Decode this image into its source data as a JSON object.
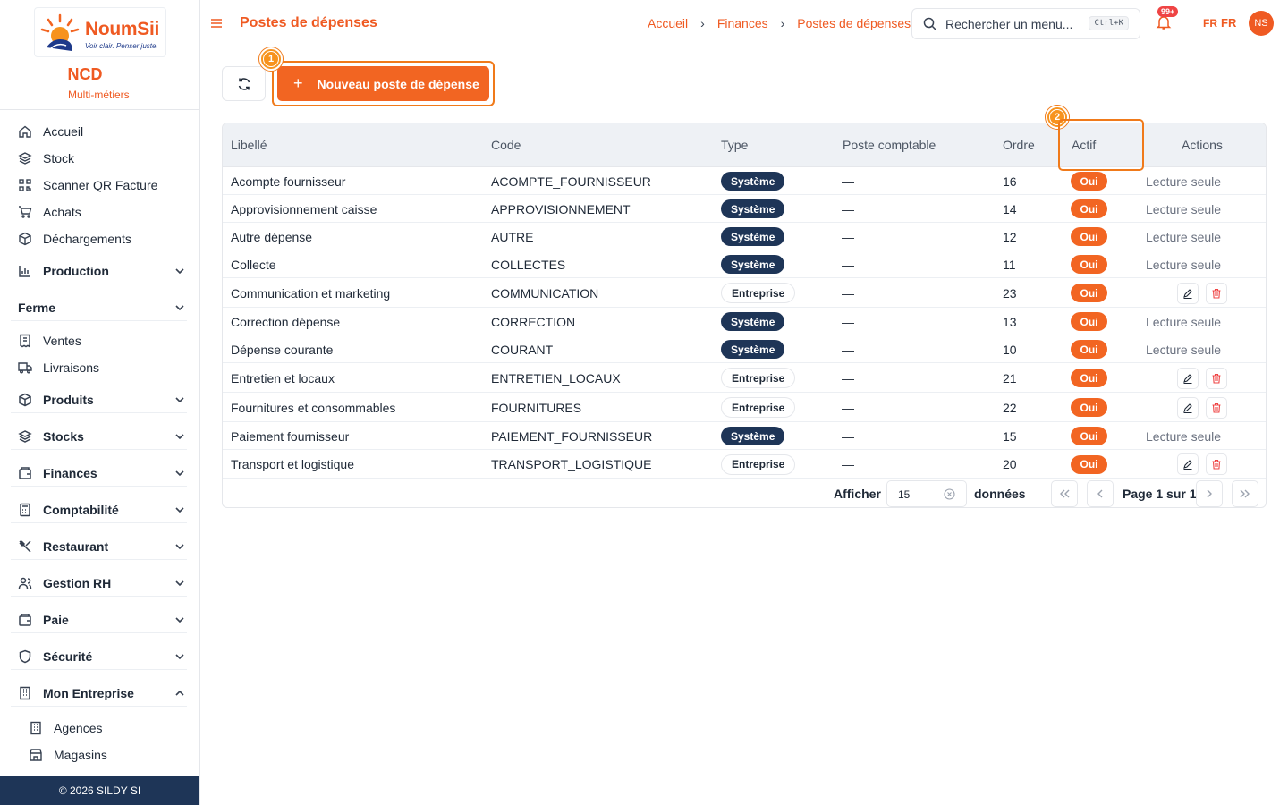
{
  "brand": {
    "logo_text": "NoumSii",
    "logo_tagline": "Voir clair. Penser juste.",
    "company": "NCD",
    "subtitle": "Multi-métiers"
  },
  "sidebar": {
    "items": [
      {
        "label": "Accueil",
        "icon": "home-icon"
      },
      {
        "label": "Stock",
        "icon": "layers-icon"
      },
      {
        "label": "Scanner QR Facture",
        "icon": "qr-icon"
      },
      {
        "label": "Achats",
        "icon": "cart-icon"
      },
      {
        "label": "Déchargements",
        "icon": "box-icon"
      }
    ],
    "groups": [
      {
        "label": "Production",
        "icon": "chart-icon",
        "expanded": false
      },
      {
        "label": "Ferme",
        "icon": "",
        "expanded": false
      },
      {
        "label": "Produits",
        "icon": "box-icon",
        "expanded": false
      },
      {
        "label": "Stocks",
        "icon": "layers-icon",
        "expanded": false
      },
      {
        "label": "Finances",
        "icon": "wallet-icon",
        "expanded": false
      },
      {
        "label": "Comptabilité",
        "icon": "calculator-icon",
        "expanded": false
      },
      {
        "label": "Restaurant",
        "icon": "utensils-icon",
        "expanded": false
      },
      {
        "label": "Gestion RH",
        "icon": "users-icon",
        "expanded": false
      },
      {
        "label": "Paie",
        "icon": "wallet-icon",
        "expanded": false
      },
      {
        "label": "Sécurité",
        "icon": "shield-icon",
        "expanded": false
      },
      {
        "label": "Mon Entreprise",
        "icon": "building-icon",
        "expanded": true
      }
    ],
    "ferme_items": [
      {
        "label": "Ventes",
        "icon": "receipt-icon"
      },
      {
        "label": "Livraisons",
        "icon": "truck-icon"
      }
    ],
    "entreprise_items": [
      {
        "label": "Agences",
        "icon": "building-icon"
      },
      {
        "label": "Magasins",
        "icon": "store-icon"
      }
    ],
    "footer": "© 2026 SILDY SI"
  },
  "header": {
    "title": "Postes de dépenses",
    "breadcrumb": [
      "Accueil",
      "Finances",
      "Postes de dépenses"
    ],
    "search_placeholder": "Rechercher un menu...",
    "search_shortcut": "Ctrl+K",
    "notifications": "99+",
    "lang_code": "FR",
    "lang_label": "FR",
    "avatar_initials": "NS"
  },
  "toolbar": {
    "new_button": "Nouveau poste de dépense",
    "markers": [
      "1",
      "2"
    ]
  },
  "table": {
    "columns": [
      "Libellé",
      "Code",
      "Type",
      "Poste comptable",
      "Ordre",
      "Actif",
      "Actions"
    ],
    "rows": [
      {
        "libelle": "Acompte fournisseur",
        "code": "ACOMPTE_FOURNISSEUR",
        "type": "Système",
        "poste": "—",
        "ordre": "16",
        "actif": "Oui",
        "actions": "Lecture seule"
      },
      {
        "libelle": "Approvisionnement caisse",
        "code": "APPROVISIONNEMENT",
        "type": "Système",
        "poste": "—",
        "ordre": "14",
        "actif": "Oui",
        "actions": "Lecture seule"
      },
      {
        "libelle": "Autre dépense",
        "code": "AUTRE",
        "type": "Système",
        "poste": "—",
        "ordre": "12",
        "actif": "Oui",
        "actions": "Lecture seule"
      },
      {
        "libelle": "Collecte",
        "code": "COLLECTES",
        "type": "Système",
        "poste": "—",
        "ordre": "11",
        "actif": "Oui",
        "actions": "Lecture seule"
      },
      {
        "libelle": "Communication et marketing",
        "code": "COMMUNICATION",
        "type": "Entreprise",
        "poste": "—",
        "ordre": "23",
        "actif": "Oui",
        "actions": ""
      },
      {
        "libelle": "Correction dépense",
        "code": "CORRECTION",
        "type": "Système",
        "poste": "—",
        "ordre": "13",
        "actif": "Oui",
        "actions": "Lecture seule"
      },
      {
        "libelle": "Dépense courante",
        "code": "COURANT",
        "type": "Système",
        "poste": "—",
        "ordre": "10",
        "actif": "Oui",
        "actions": "Lecture seule"
      },
      {
        "libelle": "Entretien et locaux",
        "code": "ENTRETIEN_LOCAUX",
        "type": "Entreprise",
        "poste": "—",
        "ordre": "21",
        "actif": "Oui",
        "actions": ""
      },
      {
        "libelle": "Fournitures et consommables",
        "code": "FOURNITURES",
        "type": "Entreprise",
        "poste": "—",
        "ordre": "22",
        "actif": "Oui",
        "actions": ""
      },
      {
        "libelle": "Paiement fournisseur",
        "code": "PAIEMENT_FOURNISSEUR",
        "type": "Système",
        "poste": "—",
        "ordre": "15",
        "actif": "Oui",
        "actions": "Lecture seule"
      },
      {
        "libelle": "Transport et logistique",
        "code": "TRANSPORT_LOGISTIQUE",
        "type": "Entreprise",
        "poste": "—",
        "ordre": "20",
        "actif": "Oui",
        "actions": ""
      }
    ]
  },
  "pagination": {
    "show_label": "Afficher",
    "page_size": "15",
    "unit_label": "données",
    "page_label": "Page 1 sur 1"
  },
  "colors": {
    "accent": "#f26522",
    "navy": "#1e3557",
    "highlight": "#f07a1a"
  }
}
